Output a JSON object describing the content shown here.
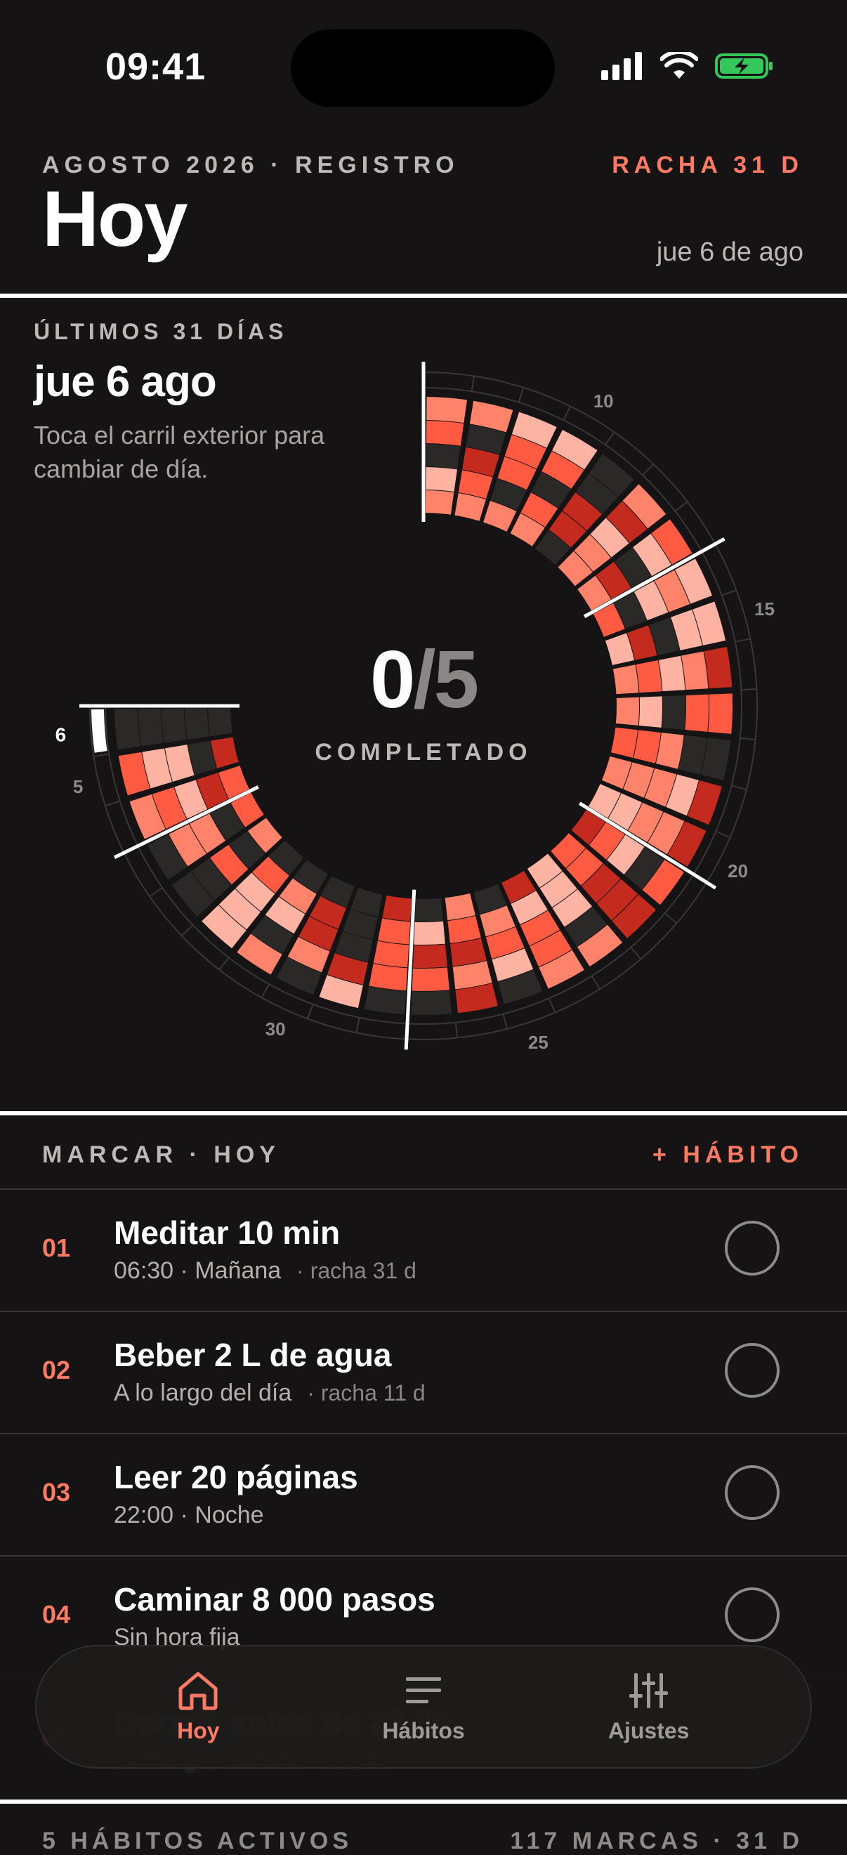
{
  "status_bar": {
    "time": "09:41"
  },
  "header": {
    "eyebrow": "AGOSTO 2026 · REGISTRO",
    "streak": "RACHA 31 D",
    "title": "Hoy",
    "date": "jue 6 de ago"
  },
  "ring": {
    "eyebrow": "ÚLTIMOS 31 DÍAS",
    "selected_date": "jue 6 ago",
    "hint": "Toca el carril exterior para cambiar de día.",
    "completed": "0",
    "total": "5",
    "completed_label": "COMPLETADO",
    "selected_day": "6",
    "day_labels": [
      "5",
      "10",
      "15",
      "20",
      "25",
      "30"
    ]
  },
  "list": {
    "title": "MARCAR · HOY",
    "add_label": "+ HÁBITO",
    "habits": [
      {
        "num": "01",
        "name": "Meditar 10 min",
        "meta": "06:30 · Mañana",
        "streak": "· racha 31 d",
        "done": false
      },
      {
        "num": "02",
        "name": "Beber 2 L de agua",
        "meta": "A lo largo del día",
        "streak": "· racha 11 d",
        "done": false
      },
      {
        "num": "03",
        "name": "Leer 20 páginas",
        "meta": "22:00 · Noche",
        "streak": "",
        "done": false
      },
      {
        "num": "04",
        "name": "Caminar 8 000 pasos",
        "meta": "Sin hora fija",
        "streak": "",
        "done": false
      },
      {
        "num": "05",
        "name": "Dormir antes de 23:30",
        "meta": "Domingo, Sábado · 23:30",
        "streak": "",
        "done": false
      }
    ]
  },
  "footer": {
    "left": "5 HÁBITOS ACTIVOS",
    "right": "117 MARCAS · 31 D"
  },
  "tabbar": {
    "tabs": [
      {
        "label": "Hoy",
        "icon": "home-icon",
        "active": true
      },
      {
        "label": "Hábitos",
        "icon": "list-icon",
        "active": false
      },
      {
        "label": "Ajustes",
        "icon": "sliders-icon",
        "active": false
      }
    ]
  },
  "colors": {
    "background": "#151313",
    "accent": "#ff7a62",
    "heat_levels": [
      "#2b2828",
      "#ffb3a3",
      "#ff826a",
      "#ff5a42",
      "#c42a1e"
    ],
    "battery": "#34c759"
  }
}
